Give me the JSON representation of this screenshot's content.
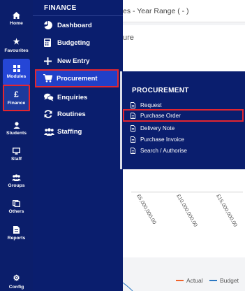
{
  "background": {
    "header_text": "es - Year Range ( - )",
    "card_title": "ure",
    "axis_ticks": [
      "£5,000,000.00",
      "£10,000,000.00",
      "£15,000,000.00"
    ],
    "legend": [
      {
        "label": "Actual",
        "color": "#f0642c"
      },
      {
        "label": "Budget",
        "color": "#2b78c2"
      }
    ]
  },
  "rail": {
    "items": [
      {
        "label": "Home",
        "icon": "home-icon"
      },
      {
        "label": "Favourites",
        "icon": "star-icon"
      },
      {
        "label": "Modules",
        "icon": "modules-icon"
      },
      {
        "label": "Finance",
        "icon": "pound-icon"
      },
      {
        "label": "Students",
        "icon": "student-icon"
      },
      {
        "label": "Staff",
        "icon": "staff-icon"
      },
      {
        "label": "Groups",
        "icon": "groups-icon"
      },
      {
        "label": "Others",
        "icon": "others-icon"
      },
      {
        "label": "Reports",
        "icon": "reports-icon"
      },
      {
        "label": "Config",
        "icon": "gear-icon"
      }
    ]
  },
  "finance_menu": {
    "title": "FINANCE",
    "items": [
      {
        "label": "Dashboard",
        "icon": "pie-chart-icon"
      },
      {
        "label": "Budgeting",
        "icon": "calculator-icon"
      },
      {
        "label": "New Entry",
        "icon": "plus-icon"
      },
      {
        "label": "Procurement",
        "icon": "cart-icon"
      },
      {
        "label": "Enquiries",
        "icon": "comments-icon"
      },
      {
        "label": "Routines",
        "icon": "sync-icon"
      },
      {
        "label": "Staffing",
        "icon": "users-icon"
      }
    ]
  },
  "procurement_menu": {
    "title": "PROCUREMENT",
    "items": [
      {
        "label": "Request",
        "icon": "document-icon"
      },
      {
        "label": "Purchase Order",
        "icon": "document-icon"
      },
      {
        "label": "Delivery Note",
        "icon": "document-icon"
      },
      {
        "label": "Purchase Invoice",
        "icon": "document-icon"
      },
      {
        "label": "Search / Authorise",
        "icon": "document-icon"
      }
    ]
  },
  "colors": {
    "sidebar": "#0b1e6b",
    "active_module": "#2546d6",
    "highlight_border": "#e32630"
  }
}
